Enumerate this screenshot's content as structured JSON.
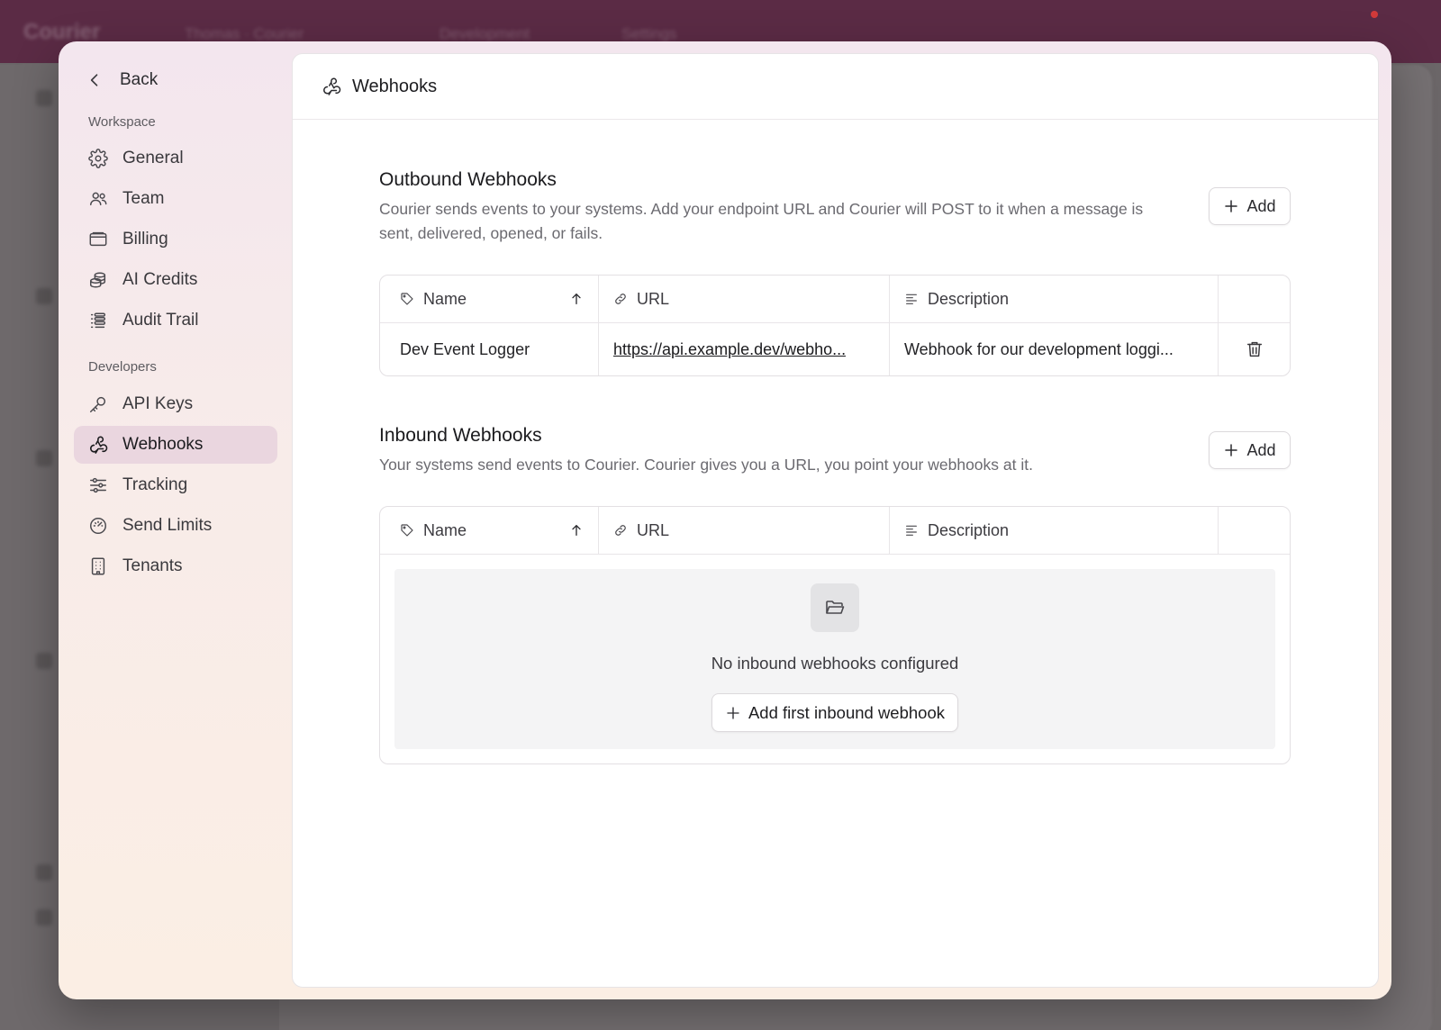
{
  "colors": {
    "topbar": "#5b2b45",
    "modal_gradient_top": "#f3e6ee",
    "modal_gradient_bottom": "#fbeee4",
    "active_nav": "#ead6df",
    "notification": "#d23a3a"
  },
  "backdrop": {
    "logo": "Courier",
    "breadcrumbs": [
      "Thomas · Courier",
      "Development",
      "Settings"
    ]
  },
  "sidebar": {
    "back_label": "Back",
    "sections": [
      {
        "label": "Workspace",
        "items": [
          {
            "label": "General",
            "icon": "gear-icon"
          },
          {
            "label": "Team",
            "icon": "users-icon"
          },
          {
            "label": "Billing",
            "icon": "wallet-icon"
          },
          {
            "label": "AI Credits",
            "icon": "coins-icon"
          },
          {
            "label": "Audit Trail",
            "icon": "list-icon"
          }
        ]
      },
      {
        "label": "Developers",
        "items": [
          {
            "label": "API Keys",
            "icon": "key-icon"
          },
          {
            "label": "Webhooks",
            "icon": "webhook-icon",
            "active": true
          },
          {
            "label": "Tracking",
            "icon": "sliders-icon"
          },
          {
            "label": "Send Limits",
            "icon": "gauge-icon"
          },
          {
            "label": "Tenants",
            "icon": "building-icon"
          }
        ]
      }
    ]
  },
  "header": {
    "title": "Webhooks",
    "icon": "webhook-icon"
  },
  "outbound": {
    "title": "Outbound Webhooks",
    "description": "Courier sends events to your systems. Add your endpoint URL and Courier will POST to it when a message is sent, delivered, opened, or fails.",
    "add_label": "Add",
    "columns": {
      "name": "Name",
      "url": "URL",
      "description": "Description"
    },
    "rows": [
      {
        "name": "Dev Event Logger",
        "url": "https://api.example.dev/webho...",
        "description": "Webhook for our development loggi..."
      }
    ]
  },
  "inbound": {
    "title": "Inbound Webhooks",
    "description": "Your systems send events to Courier. Courier gives you a URL, you point your webhooks at it.",
    "add_label": "Add",
    "columns": {
      "name": "Name",
      "url": "URL",
      "description": "Description"
    },
    "empty_text": "No inbound webhooks configured",
    "empty_button": "Add first inbound webhook"
  }
}
